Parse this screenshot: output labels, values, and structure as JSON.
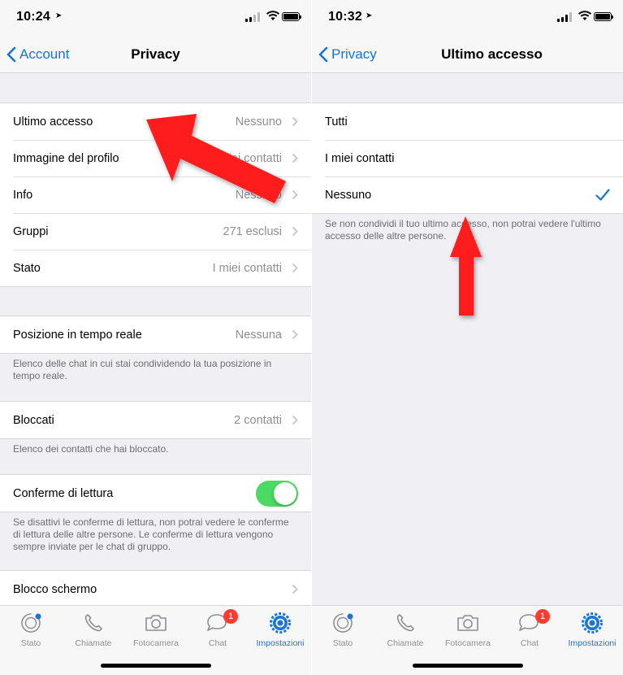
{
  "left": {
    "status_time": "10:24",
    "back_label": "Account",
    "title": "Privacy",
    "privacy_rows": [
      {
        "label": "Ultimo accesso",
        "value": "Nessuno"
      },
      {
        "label": "Immagine del profilo",
        "value": "I miei contatti"
      },
      {
        "label": "Info",
        "value": "Nessuno"
      },
      {
        "label": "Gruppi",
        "value": "271 esclusi"
      },
      {
        "label": "Stato",
        "value": "I miei contatti"
      }
    ],
    "live_location": {
      "label": "Posizione in tempo reale",
      "value": "Nessuna",
      "footnote": "Elenco delle chat in cui stai condividendo la tua posizione in tempo reale."
    },
    "blocked": {
      "label": "Bloccati",
      "value": "2 contatti",
      "footnote": "Elenco dei contatti che hai bloccato."
    },
    "read_receipts": {
      "label": "Conferme di lettura",
      "enabled": true,
      "footnote": "Se disattivi le conferme di lettura, non potrai vedere le conferme di lettura delle altre persone. Le conferme di lettura vengono sempre inviate per le chat di gruppo."
    },
    "screen_lock": {
      "label": "Blocco schermo"
    }
  },
  "right": {
    "status_time": "10:32",
    "back_label": "Privacy",
    "title": "Ultimo accesso",
    "options": [
      {
        "label": "Tutti",
        "selected": false
      },
      {
        "label": "I miei contatti",
        "selected": false
      },
      {
        "label": "Nessuno",
        "selected": true
      }
    ],
    "footnote": "Se non condividi il tuo ultimo accesso, non potrai vedere l'ultimo accesso delle altre persone."
  },
  "tabs": [
    {
      "label": "Stato",
      "icon": "status-icon"
    },
    {
      "label": "Chiamate",
      "icon": "phone-icon"
    },
    {
      "label": "Fotocamera",
      "icon": "camera-icon"
    },
    {
      "label": "Chat",
      "icon": "chat-icon",
      "badge": "1"
    },
    {
      "label": "Impostazioni",
      "icon": "settings-gear-icon",
      "active": true
    }
  ],
  "colors": {
    "accent": "#1a73d9",
    "toggle_on": "#4cd964",
    "badge": "#ff3b30",
    "annotation_arrow": "#ff1a1a"
  }
}
